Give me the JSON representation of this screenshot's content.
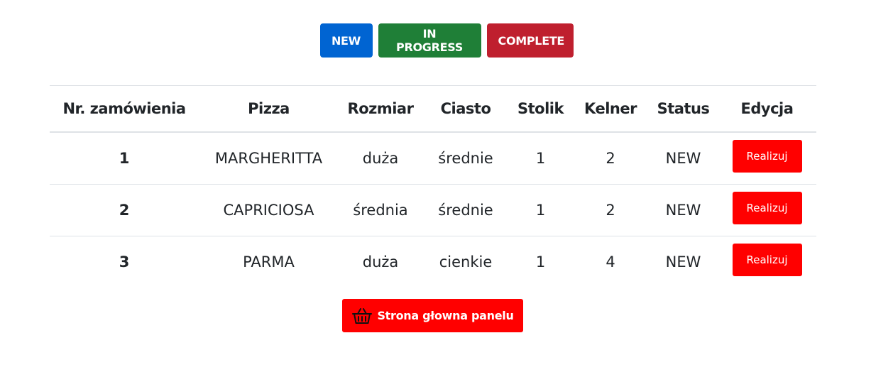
{
  "filters": {
    "new_label": "NEW",
    "in_progress_label": "IN PROGRESS",
    "complete_label": "COMPLETE",
    "colors": {
      "new": "#0064d2",
      "in_progress": "#1f7f37",
      "complete": "#bf1f2e"
    }
  },
  "table": {
    "headers": [
      "Nr. zamówienia",
      "Pizza",
      "Rozmiar",
      "Ciasto",
      "Stolik",
      "Kelner",
      "Status",
      "Edycja"
    ],
    "rows": [
      {
        "nr": "1",
        "pizza": "MARGHERITTA",
        "rozmiar": "duża",
        "ciasto": "średnie",
        "stolik": "1",
        "kelner": "2",
        "status": "NEW",
        "action": "Realizuj"
      },
      {
        "nr": "2",
        "pizza": "CAPRICIOSA",
        "rozmiar": "średnia",
        "ciasto": "średnie",
        "stolik": "1",
        "kelner": "2",
        "status": "NEW",
        "action": "Realizuj"
      },
      {
        "nr": "3",
        "pizza": "PARMA",
        "rozmiar": "duża",
        "ciasto": "cienkie",
        "stolik": "1",
        "kelner": "4",
        "status": "NEW",
        "action": "Realizuj"
      }
    ]
  },
  "home_button": {
    "label": "Strona głowna panelu",
    "icon": "basket-icon"
  },
  "accent_color": "#ff0000"
}
